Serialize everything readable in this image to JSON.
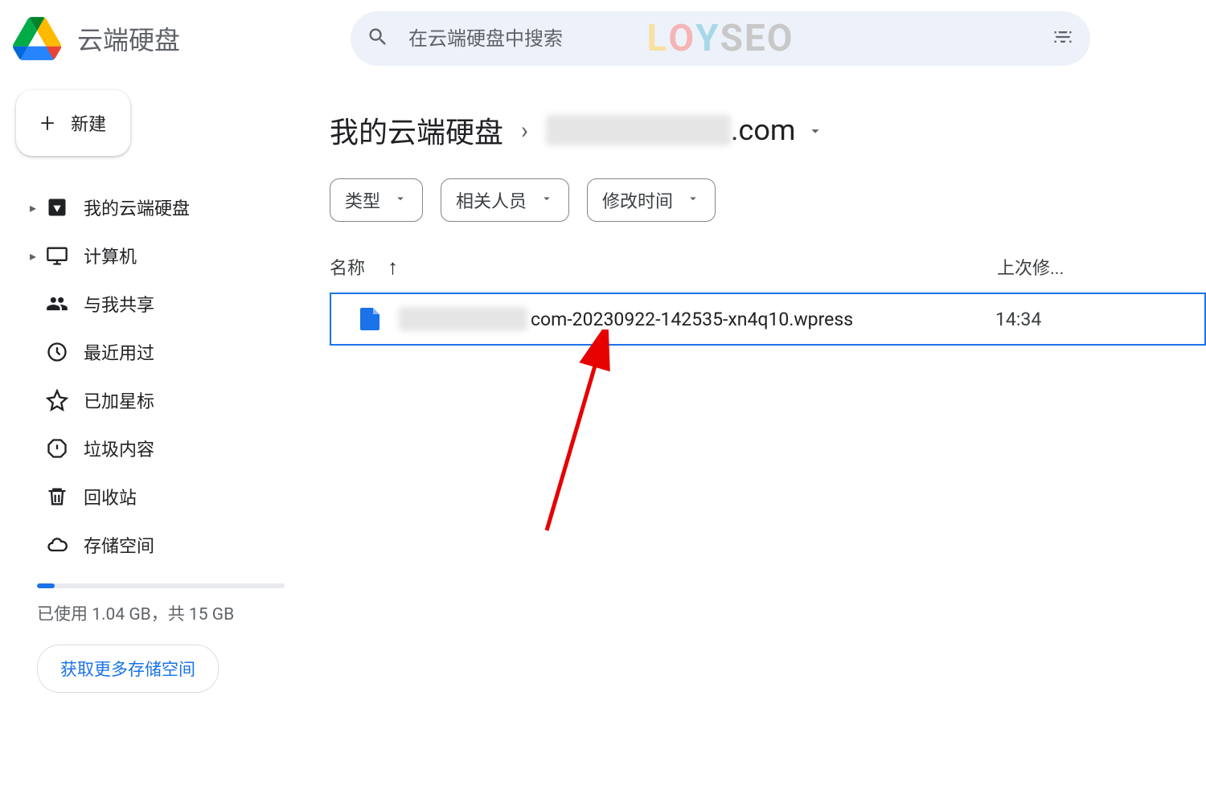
{
  "header": {
    "app_title": "云端硬盘",
    "search_placeholder": "在云端硬盘中搜索",
    "watermark": "LOYSEO"
  },
  "sidebar": {
    "new_button": "新建",
    "items": [
      {
        "label": "我的云端硬盘",
        "expandable": true
      },
      {
        "label": "计算机",
        "expandable": true
      },
      {
        "label": "与我共享",
        "expandable": false
      },
      {
        "label": "最近用过",
        "expandable": false
      },
      {
        "label": "已加星标",
        "expandable": false
      },
      {
        "label": "垃圾内容",
        "expandable": false
      },
      {
        "label": "回收站",
        "expandable": false
      },
      {
        "label": "存储空间",
        "expandable": false
      }
    ],
    "storage_text": "已使用 1.04 GB，共 15 GB",
    "storage_used_gb": 1.04,
    "storage_total_gb": 15,
    "storage_button": "获取更多存储空间"
  },
  "breadcrumb": {
    "root": "我的云端硬盘",
    "current_suffix": ".com"
  },
  "filters": [
    {
      "label": "类型"
    },
    {
      "label": "相关人员"
    },
    {
      "label": "修改时间"
    }
  ],
  "table": {
    "col_name": "名称",
    "col_modified": "上次修..."
  },
  "files": [
    {
      "name_visible_suffix": "com-20230922-142535-xn4q10.wpress",
      "modified": "14:34",
      "selected": true
    }
  ]
}
